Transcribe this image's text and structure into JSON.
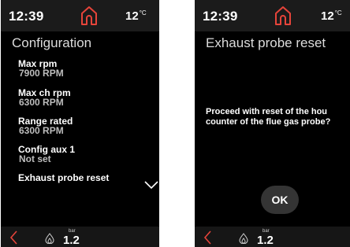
{
  "colors": {
    "accent": "#e6443a",
    "screen_background": "#000000",
    "status_bar_background": "#1b1b1b",
    "ok_button_background": "#343434"
  },
  "screens": [
    {
      "status": {
        "time": "12:39",
        "temperature": "12",
        "temperature_unit": "°C"
      },
      "title": "Configuration",
      "menu_items": [
        {
          "label": "Max rpm",
          "value": "7900 RPM"
        },
        {
          "label": "Max ch rpm",
          "value": "6300 RPM"
        },
        {
          "label": "Range rated",
          "value": "6300 RPM"
        },
        {
          "label": "Config aux 1",
          "value": "Not set"
        },
        {
          "label": "Exhaust probe reset",
          "value": ""
        }
      ],
      "icons": {
        "home": "home-icon",
        "scroll_down": "chevron-down-icon",
        "back": "chevron-left-icon",
        "flame": "flame-icon"
      },
      "pressure": {
        "unit": "bar",
        "value": "1.2"
      }
    },
    {
      "status": {
        "time": "12:39",
        "temperature": "12",
        "temperature_unit": "°C"
      },
      "title": "Exhaust probe reset",
      "prompt_lines": [
        "Proceed with reset of the hou",
        "counter of the flue gas probe?"
      ],
      "ok_label": "OK",
      "icons": {
        "home": "home-icon",
        "back": "chevron-left-icon",
        "flame": "flame-icon"
      },
      "pressure": {
        "unit": "bar",
        "value": "1.2"
      }
    }
  ]
}
